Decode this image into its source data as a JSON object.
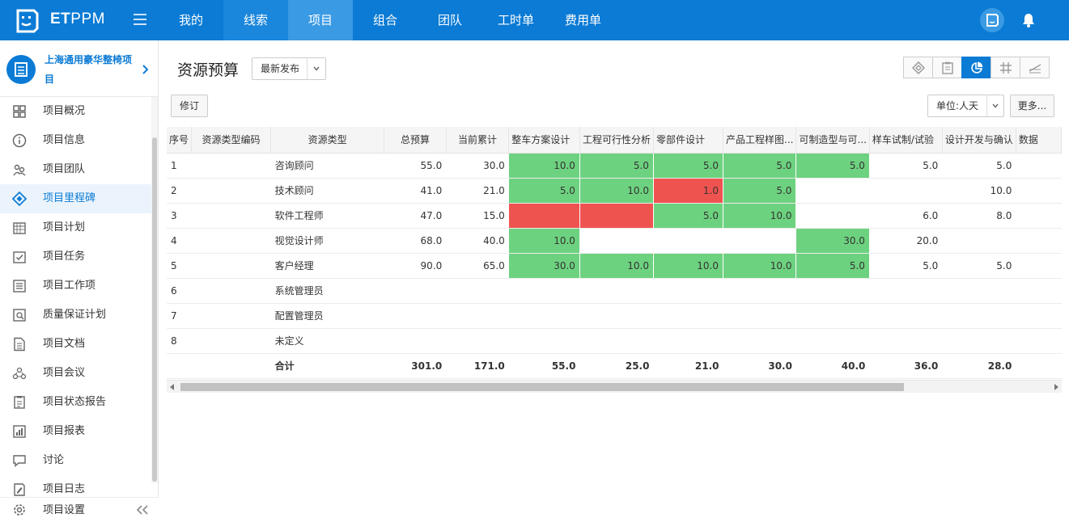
{
  "brand": {
    "name_bold": "ET",
    "name_rest": "PPM"
  },
  "nav": [
    {
      "label": "我的",
      "state": "normal",
      "width": 80
    },
    {
      "label": "线索",
      "state": "dim",
      "width": 80
    },
    {
      "label": "项目",
      "state": "active",
      "width": 80
    },
    {
      "label": "组合",
      "state": "normal",
      "width": 80
    },
    {
      "label": "团队",
      "state": "normal",
      "width": 80
    },
    {
      "label": "工时单",
      "state": "normal",
      "width": 83
    },
    {
      "label": "费用单",
      "state": "normal",
      "width": 83
    }
  ],
  "project": {
    "name": "上海通用豪华整椅项目"
  },
  "menu": [
    {
      "label": "项目概况",
      "icon": "grid-icon",
      "active": false
    },
    {
      "label": "项目信息",
      "icon": "info-icon",
      "active": false
    },
    {
      "label": "项目团队",
      "icon": "team-icon",
      "active": false
    },
    {
      "label": "项目里程碑",
      "icon": "milestone-icon",
      "active": true
    },
    {
      "label": "项目计划",
      "icon": "calendar-icon",
      "active": false
    },
    {
      "label": "项目任务",
      "icon": "task-icon",
      "active": false
    },
    {
      "label": "项目工作项",
      "icon": "list-icon",
      "active": false
    },
    {
      "label": "质量保证计划",
      "icon": "quality-icon",
      "active": false
    },
    {
      "label": "项目文档",
      "icon": "document-icon",
      "active": false
    },
    {
      "label": "项目会议",
      "icon": "meeting-icon",
      "active": false
    },
    {
      "label": "项目状态报告",
      "icon": "report-icon",
      "active": false
    },
    {
      "label": "项目报表",
      "icon": "chart-icon",
      "active": false
    },
    {
      "label": "讨论",
      "icon": "comment-icon",
      "active": false
    },
    {
      "label": "项目日志",
      "icon": "log-icon",
      "active": false
    }
  ],
  "sidebar_footer": {
    "label": "项目设置"
  },
  "page": {
    "title": "资源预算",
    "version_select": "最新发布",
    "revise_button": "修订",
    "unit_select": "单位:人天",
    "more_button": "更多..."
  },
  "table": {
    "columns": [
      "序号",
      "资源类型编码",
      "资源类型",
      "总预算",
      "当前累计",
      "整车方案设计",
      "工程可行性分析",
      "零部件设计",
      "产品工程样图...",
      "可制造型与可...",
      "样车试制/试验",
      "设计开发与确认",
      "数据"
    ],
    "rows": [
      {
        "cells": [
          "1",
          "",
          "咨询顾问",
          "55.0",
          "30.0",
          "10.0",
          "5.0",
          "5.0",
          "5.0",
          "5.0",
          "5.0",
          "5.0",
          ""
        ],
        "colors": [
          "",
          "",
          "",
          "",
          "",
          "g",
          "g",
          "g",
          "g",
          "g",
          "",
          "",
          ""
        ]
      },
      {
        "cells": [
          "2",
          "",
          "技术顾问",
          "41.0",
          "21.0",
          "5.0",
          "10.0",
          "1.0",
          "5.0",
          "",
          "",
          "10.0",
          ""
        ],
        "colors": [
          "",
          "",
          "",
          "",
          "",
          "g",
          "g",
          "r",
          "g",
          "",
          "",
          "",
          ""
        ]
      },
      {
        "cells": [
          "3",
          "",
          "软件工程师",
          "47.0",
          "15.0",
          "",
          "",
          "5.0",
          "10.0",
          "",
          "6.0",
          "8.0",
          ""
        ],
        "colors": [
          "",
          "",
          "",
          "",
          "",
          "r",
          "r",
          "g",
          "g",
          "",
          "",
          "",
          ""
        ]
      },
      {
        "cells": [
          "4",
          "",
          "视觉设计师",
          "68.0",
          "40.0",
          "10.0",
          "",
          "",
          "",
          "30.0",
          "20.0",
          "",
          ""
        ],
        "colors": [
          "",
          "",
          "",
          "",
          "",
          "g",
          "",
          "",
          "",
          "g",
          "",
          "",
          ""
        ]
      },
      {
        "cells": [
          "5",
          "",
          "客户经理",
          "90.0",
          "65.0",
          "30.0",
          "10.0",
          "10.0",
          "10.0",
          "5.0",
          "5.0",
          "5.0",
          ""
        ],
        "colors": [
          "",
          "",
          "",
          "",
          "",
          "g",
          "g",
          "g",
          "g",
          "g",
          "",
          "",
          ""
        ]
      },
      {
        "cells": [
          "6",
          "",
          "系统管理员",
          "",
          "",
          "",
          "",
          "",
          "",
          "",
          "",
          "",
          ""
        ],
        "colors": []
      },
      {
        "cells": [
          "7",
          "",
          "配置管理员",
          "",
          "",
          "",
          "",
          "",
          "",
          "",
          "",
          "",
          ""
        ],
        "colors": []
      },
      {
        "cells": [
          "8",
          "",
          "未定义",
          "",
          "",
          "",
          "",
          "",
          "",
          "",
          "",
          "",
          ""
        ],
        "colors": []
      }
    ],
    "total": {
      "cells": [
        "",
        "",
        "合计",
        "301.0",
        "171.0",
        "55.0",
        "25.0",
        "21.0",
        "30.0",
        "40.0",
        "36.0",
        "28.0",
        ""
      ]
    }
  },
  "colors": {
    "primary": "#0b7bd5",
    "ok_green": "#6dd27f",
    "over_red": "#ef5350"
  }
}
